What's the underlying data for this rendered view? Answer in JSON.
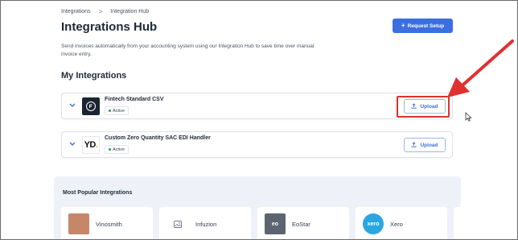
{
  "breadcrumb": {
    "items": [
      "Integrations",
      "Integration Hub"
    ],
    "separator": ">"
  },
  "header": {
    "title": "Integrations Hub",
    "request_button": {
      "icon": "plus-icon",
      "label": "Request Setup"
    },
    "description": "Send invoices automatically from your accounting system using our Integration Hub to save time over manual invoice entry."
  },
  "my_integrations": {
    "title": "My Integrations",
    "items": [
      {
        "name": "Fintech Standard CSV",
        "status": "Active",
        "upload_label": "Upload",
        "logo": "fintech-logo"
      },
      {
        "name": "Custom Zero Quantity SAC EDI Handler",
        "status": "Active",
        "upload_label": "Upload",
        "logo": "yd-logo",
        "logo_text": "YD",
        "logo_accent": "."
      }
    ]
  },
  "popular_integrations": {
    "title": "Most Popular Integrations",
    "items": [
      {
        "name": "Vinosmith"
      },
      {
        "name": "Infuzion"
      },
      {
        "name": "EoStar",
        "logo_text": "eo"
      },
      {
        "name": "Xero",
        "logo_text": "xero"
      }
    ]
  },
  "colors": {
    "accent": "#3b6fe0",
    "active_dot": "#22a05b",
    "annotation": "#e0302f"
  }
}
